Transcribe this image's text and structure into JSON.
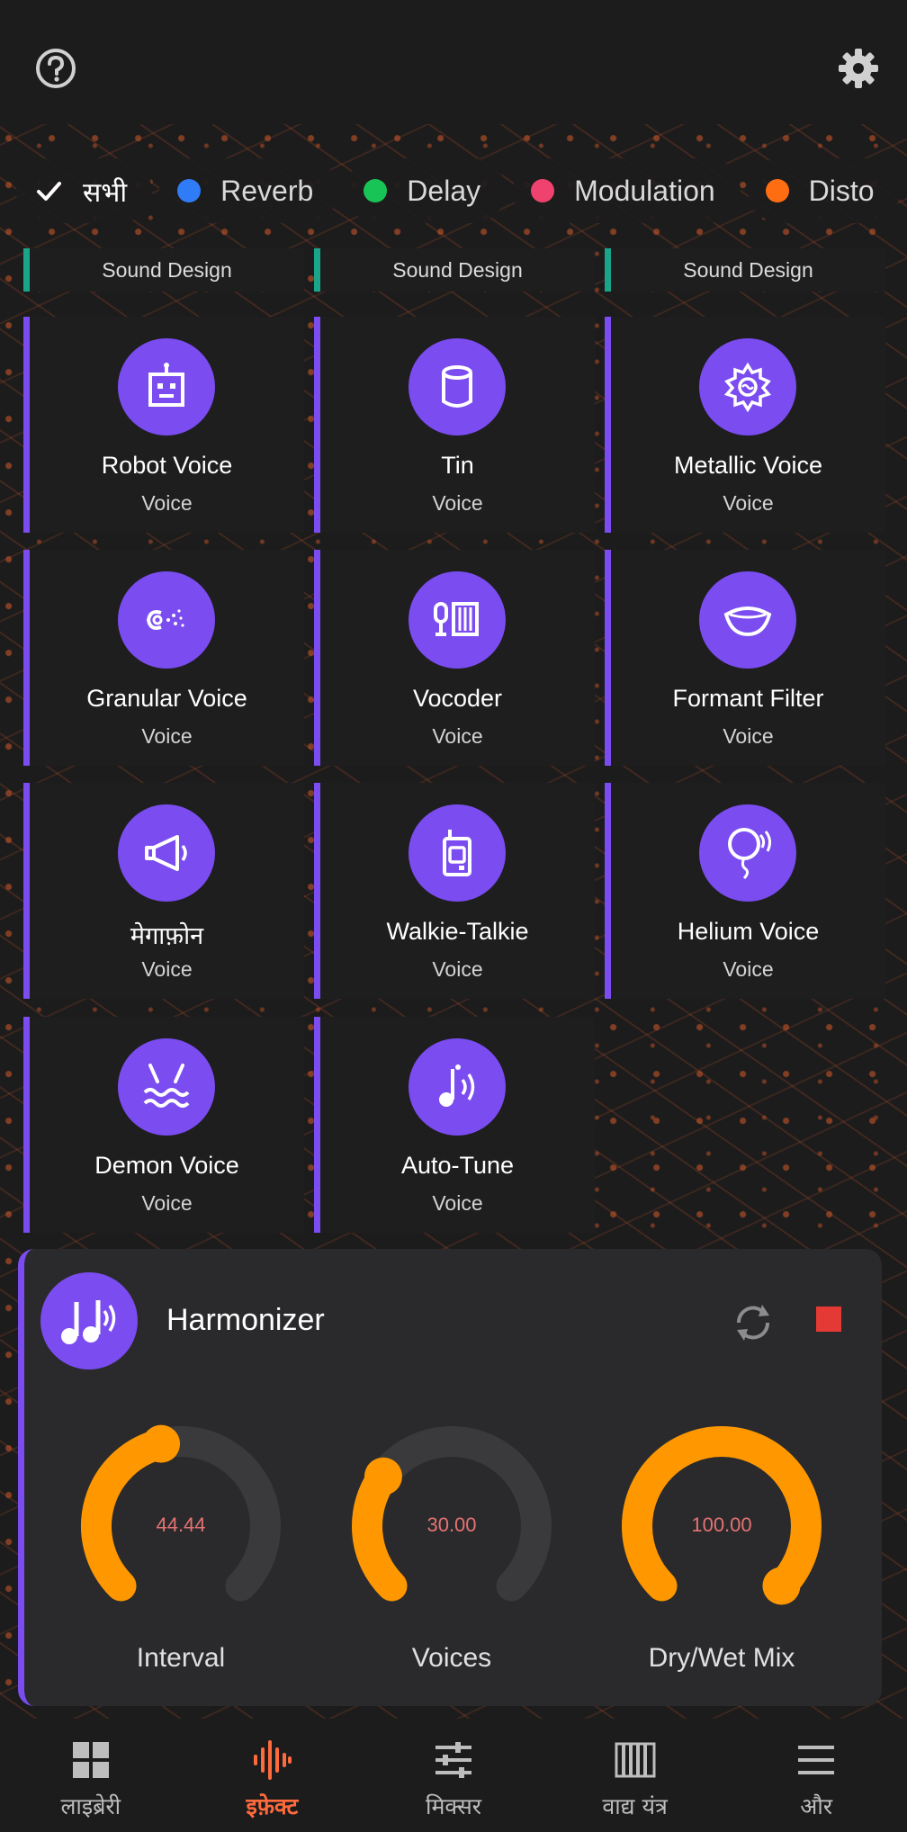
{
  "colors": {
    "accent_purple": "#7b4cf0",
    "accent_orange": "#ff9800",
    "nav_active": "#ff6a3d",
    "header_teal": "#1aa58a",
    "stop_red": "#e53935"
  },
  "toolbar": {
    "help_icon": "help-circle-icon",
    "settings_icon": "gear-icon"
  },
  "filters": [
    {
      "label": "सभी",
      "selected": true,
      "icon": "check-icon"
    },
    {
      "label": "Reverb",
      "color": "#2f7cf6"
    },
    {
      "label": "Delay",
      "color": "#19c456"
    },
    {
      "label": "Modulation",
      "color": "#f0426e"
    },
    {
      "label": "Disto",
      "color": "#ff6d12"
    }
  ],
  "headers": [
    "Sound Design",
    "Sound Design",
    "Sound Design"
  ],
  "effects": [
    {
      "name": "Robot Voice",
      "category": "Voice",
      "icon": "robot-icon"
    },
    {
      "name": "Tin",
      "category": "Voice",
      "icon": "tin-can-icon"
    },
    {
      "name": "Metallic Voice",
      "category": "Voice",
      "icon": "metallic-icon"
    },
    {
      "name": "Granular Voice",
      "category": "Voice",
      "icon": "granular-icon"
    },
    {
      "name": "Vocoder",
      "category": "Voice",
      "icon": "vocoder-icon"
    },
    {
      "name": "Formant Filter",
      "category": "Voice",
      "icon": "formant-icon"
    },
    {
      "name": "मेगाफ़ोन",
      "category": "Voice",
      "icon": "megaphone-icon"
    },
    {
      "name": "Walkie-Talkie",
      "category": "Voice",
      "icon": "walkie-talkie-icon"
    },
    {
      "name": "Helium Voice",
      "category": "Voice",
      "icon": "helium-balloon-icon"
    },
    {
      "name": "Demon Voice",
      "category": "Voice",
      "icon": "demon-icon"
    },
    {
      "name": "Auto-Tune",
      "category": "Voice",
      "icon": "auto-tune-icon"
    }
  ],
  "active_effect": {
    "name": "Harmonizer",
    "icon": "harmonizer-icon",
    "knobs": [
      {
        "label": "Interval",
        "value": "44.44",
        "fraction": 0.45
      },
      {
        "label": "Voices",
        "value": "30.00",
        "fraction": 0.3
      },
      {
        "label": "Dry/Wet Mix",
        "value": "100.00",
        "fraction": 1.0
      }
    ]
  },
  "nav": [
    {
      "label": "लाइब्रेरी",
      "icon": "library-grid-icon",
      "active": false
    },
    {
      "label": "इफ़ेक्ट",
      "icon": "effects-waveform-icon",
      "active": true
    },
    {
      "label": "मिक्सर",
      "icon": "mixer-sliders-icon",
      "active": false
    },
    {
      "label": "वाद्य यंत्र",
      "icon": "piano-keys-icon",
      "active": false
    },
    {
      "label": "और",
      "icon": "menu-icon",
      "active": false
    }
  ]
}
